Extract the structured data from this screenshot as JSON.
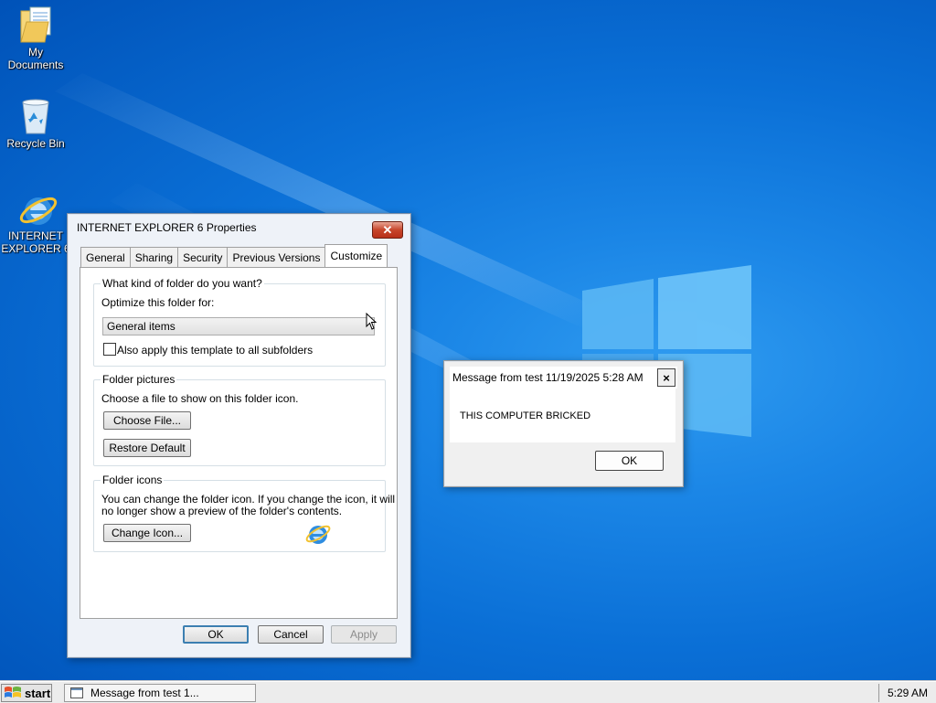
{
  "desktop": {
    "icons": [
      {
        "label_line1": "My",
        "label_line2": "Documents",
        "icon": "folder-documents-icon"
      },
      {
        "label_line1": "Recycle Bin",
        "label_line2": "",
        "icon": "recycle-bin-icon"
      },
      {
        "label_line1": "INTERNET",
        "label_line2": "EXPLORER 6",
        "icon": "internet-explorer-icon"
      }
    ]
  },
  "properties_dialog": {
    "title": "INTERNET EXPLORER 6 Properties",
    "tabs": [
      "General",
      "Sharing",
      "Security",
      "Previous Versions",
      "Customize"
    ],
    "active_tab": "Customize",
    "folder_type_group": {
      "legend": "What kind of folder do you want?",
      "optimize_label": "Optimize this folder for:",
      "optimize_value": "General items",
      "apply_subfolders_label": "Also apply this template to all subfolders",
      "apply_subfolders_checked": false
    },
    "folder_pictures_group": {
      "legend": "Folder pictures",
      "description": "Choose a file to show on this folder icon.",
      "choose_file_button": "Choose File...",
      "restore_default_button": "Restore Default"
    },
    "folder_icons_group": {
      "legend": "Folder icons",
      "description_line1": "You can change the folder icon. If you change the icon, it will",
      "description_line2": "no longer show a preview of the folder's contents.",
      "change_icon_button": "Change Icon..."
    },
    "buttons": {
      "ok": "OK",
      "cancel": "Cancel",
      "apply": "Apply"
    }
  },
  "message_box": {
    "title": "Message from test 11/19/2025 5:28 AM",
    "message": "THIS COMPUTER BRICKED",
    "ok": "OK",
    "close_glyph": "×"
  },
  "taskbar": {
    "start_label": "start",
    "task_button": "Message from test 1...",
    "clock": "5:29 AM"
  },
  "colors": {
    "desktop": "#0a6fd6",
    "dialog_close": "#c7462b",
    "default_button_border": "#3c7fb1"
  }
}
